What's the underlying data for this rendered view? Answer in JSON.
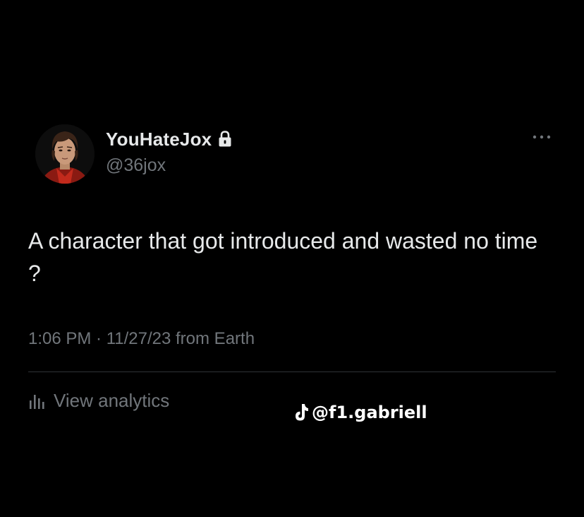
{
  "tweet": {
    "author": {
      "display_name": "YouHateJox",
      "handle": "@36jox",
      "protected_icon": "lock-icon",
      "avatar": "avatar-image"
    },
    "more_icon": "more-horizontal-icon",
    "text": "A character that got introduced and wasted no time ?",
    "timestamp": "1:06 PM · 11/27/23 from Earth",
    "analytics": {
      "icon": "analytics-bars-icon",
      "label": "View analytics"
    }
  },
  "watermark": {
    "icon": "tiktok-icon",
    "text": "@f1.gabriell"
  },
  "colors": {
    "background": "#000000",
    "primary_text": "#e7e9ea",
    "secondary_text": "#71767b",
    "divider": "#2f3336"
  }
}
